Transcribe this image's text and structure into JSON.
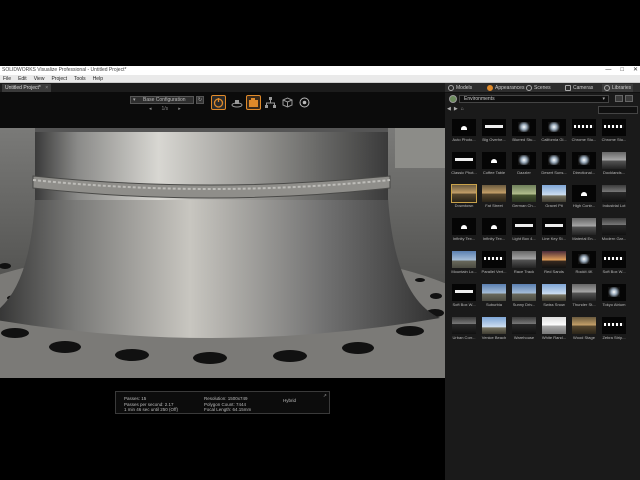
{
  "app": {
    "title": "SOLIDWORKS Visualize Professional - Untitled Project*",
    "window_controls": [
      "—",
      "□",
      "✕"
    ]
  },
  "menu": [
    "File",
    "Edit",
    "View",
    "Project",
    "Tools",
    "Help"
  ],
  "document_tab": "Untitled Project*",
  "toolbar": {
    "configuration": "Base Configuration",
    "config_prev": "◂",
    "config_count": "1/s",
    "config_next": "▸"
  },
  "palette": {
    "tabs": [
      "Models",
      "Appearances",
      "Scenes",
      "Cameras",
      "Libraries"
    ],
    "library_type": "Environments",
    "nav": [
      "◀",
      "▶",
      "⌂"
    ],
    "search_placeholder": ""
  },
  "environments": [
    {
      "label": "Auto Photo...",
      "style": "t-dark"
    },
    {
      "label": "Big Overhe...",
      "style": "t-bar"
    },
    {
      "label": "Blurred Stu...",
      "style": "t-glow"
    },
    {
      "label": "California Gl...",
      "style": "t-glow"
    },
    {
      "label": "Chrome Stu...",
      "style": "t-row"
    },
    {
      "label": "Chrome Stu...",
      "style": "t-row"
    },
    {
      "label": "Classic Phot...",
      "style": "t-bar"
    },
    {
      "label": "Coffee Table",
      "style": "t-dark"
    },
    {
      "label": "Dazzler",
      "style": "t-glow"
    },
    {
      "label": "Desert Suns...",
      "style": "t-glow"
    },
    {
      "label": "Directional...",
      "style": "t-glow"
    },
    {
      "label": "Docklands...",
      "style": "t-grey"
    },
    {
      "label": "Downtown",
      "style": "t-warm"
    },
    {
      "label": "Fat Street",
      "style": "t-warm"
    },
    {
      "label": "German Ch...",
      "style": "t-green"
    },
    {
      "label": "Gravel Pit",
      "style": "t-sky"
    },
    {
      "label": "High Contr...",
      "style": "t-dark"
    },
    {
      "label": "Industrial Lot",
      "style": "t-indoor"
    },
    {
      "label": "Infinity Tex...",
      "style": "t-dark"
    },
    {
      "label": "Infinity Tex...",
      "style": "t-dark"
    },
    {
      "label": "Light Box 4...",
      "style": "t-bar"
    },
    {
      "label": "Line Key St...",
      "style": "t-bar"
    },
    {
      "label": "Material En...",
      "style": "t-grey"
    },
    {
      "label": "Modern Gar...",
      "style": "t-indoor"
    },
    {
      "label": "Mountain Lo...",
      "style": "t-blue"
    },
    {
      "label": "Parallel Vert...",
      "style": "t-row"
    },
    {
      "label": "Race Track",
      "style": "t-grey"
    },
    {
      "label": "Red Sands",
      "style": "t-sunset"
    },
    {
      "label": "Rockit 4K",
      "style": "t-glow"
    },
    {
      "label": "Soft Box W...",
      "style": "t-row"
    },
    {
      "label": "Soft Box W...",
      "style": "t-bar"
    },
    {
      "label": "Suburbia",
      "style": "t-blue"
    },
    {
      "label": "Sunny Driv...",
      "style": "t-blue"
    },
    {
      "label": "Swiss Snow",
      "style": "t-sky"
    },
    {
      "label": "Thunder St...",
      "style": "t-grey"
    },
    {
      "label": "Tokyo Atrium",
      "style": "t-glow"
    },
    {
      "label": "Urban Corr...",
      "style": "t-indoor"
    },
    {
      "label": "Venice Beach",
      "style": "t-sky"
    },
    {
      "label": "Warehouse",
      "style": "t-indoor"
    },
    {
      "label": "White Rand...",
      "style": "t-white"
    },
    {
      "label": "Wood Stage",
      "style": "t-warm"
    },
    {
      "label": "Zebra Strip...",
      "style": "t-row"
    }
  ],
  "selected_environment": 12,
  "stats": {
    "passes": "Passes: 15",
    "passes_per_second": "Passes per second: 2.17",
    "eta": "1 min 46 sec until 250 (Off)",
    "resolution": "Resolution: 1500x749",
    "polygon_count": "Polygon Count: 7444",
    "focal_length": "Focal Length: 64.15mm",
    "render_mode": "Hybrid"
  },
  "colors": {
    "accent": "#e08a2a",
    "selection": "#c9a24a",
    "panel_bg": "#1a1a1a"
  }
}
